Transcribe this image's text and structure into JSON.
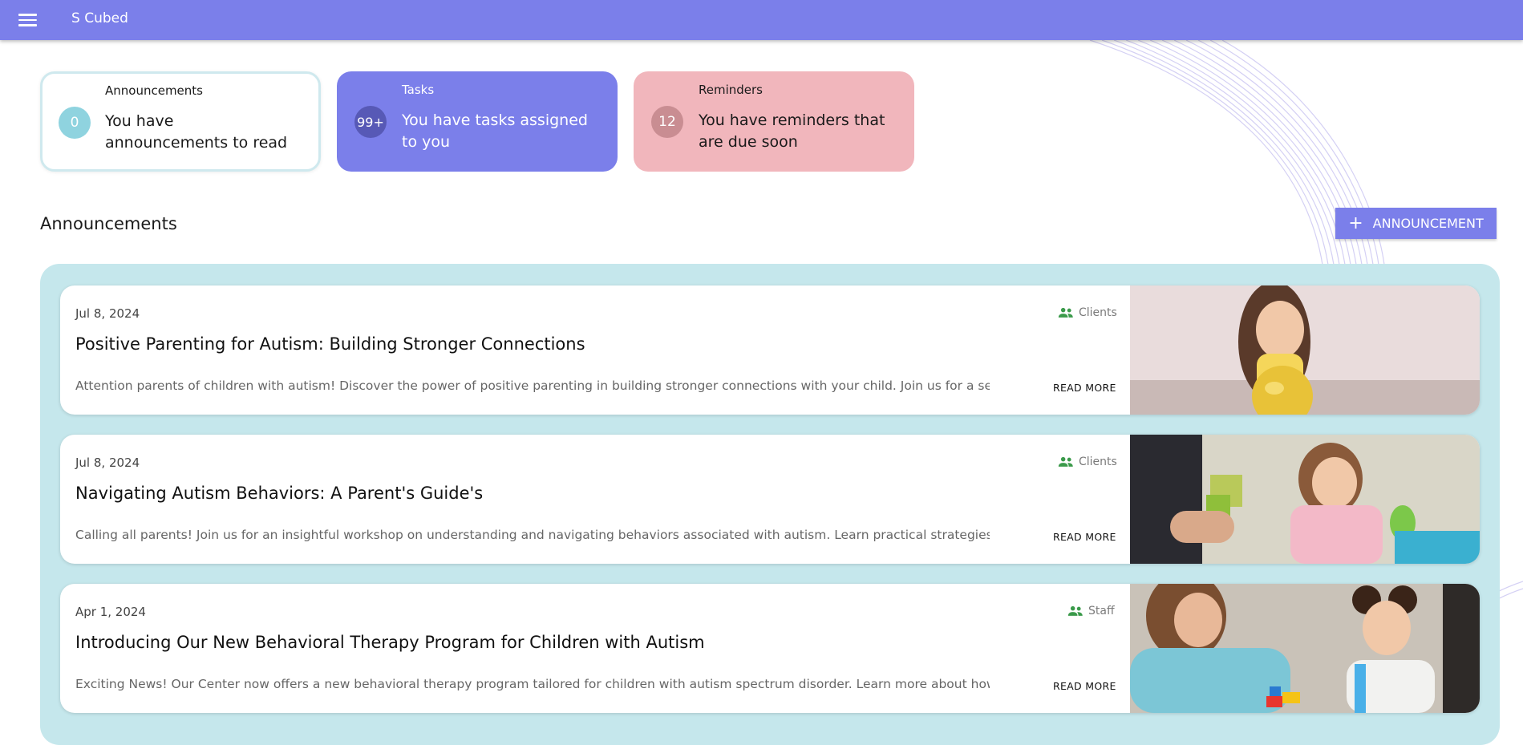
{
  "app": {
    "title": "S Cubed"
  },
  "summary": {
    "announcements": {
      "label": "Announcements",
      "count": "0",
      "message": "You have announcements to read"
    },
    "tasks": {
      "label": "Tasks",
      "count": "99+",
      "message": "You have tasks assigned to you"
    },
    "reminders": {
      "label": "Reminders",
      "count": "12",
      "message": "You have reminders that are due soon"
    }
  },
  "announcements_section": {
    "title": "Announcements",
    "add_button": "ANNOUNCEMENT",
    "read_more": "READ MORE",
    "items": [
      {
        "date": "Jul 8, 2024",
        "audience": "Clients",
        "title": "Positive Parenting for Autism: Building Stronger Connections",
        "excerpt": "Attention parents of children with autism! Discover the power of positive parenting in building stronger connections with your child. Join us for a seminar t"
      },
      {
        "date": "Jul 8, 2024",
        "audience": "Clients",
        "title": "Navigating Autism Behaviors: A Parent's Guide's",
        "excerpt": "Calling all parents! Join us for an insightful workshop on understanding and navigating behaviors associated with autism. Learn practical strategies and g"
      },
      {
        "date": "Apr 1, 2024",
        "audience": "Staff",
        "title": "Introducing Our New Behavioral Therapy Program for Children with Autism",
        "excerpt": "Exciting News! Our Center now offers a new behavioral therapy program tailored for children with autism spectrum disorder. Learn more about how we're"
      }
    ]
  },
  "colors": {
    "primary": "#7b7fea",
    "feed_bg": "#c5e7ec",
    "reminders": "#f1b6bc",
    "audience_icon": "#3a9a4a"
  }
}
